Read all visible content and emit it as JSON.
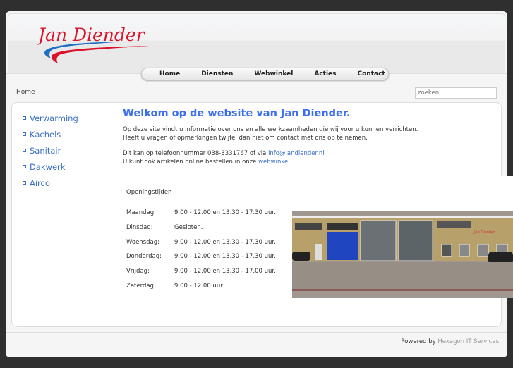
{
  "brand": {
    "name": "Jan Diender",
    "colors": {
      "red": "#d9142a",
      "blue": "#1f6fc4",
      "accent": "#3b6ef0"
    }
  },
  "nav": [
    "Home",
    "Diensten",
    "Webwinkel",
    "Acties",
    "Contact"
  ],
  "breadcrumb": "Home",
  "search": {
    "placeholder": "zoeken..."
  },
  "sidebar": [
    "Verwarming",
    "Kachels",
    "Sanitair",
    "Dakwerk",
    "Airco"
  ],
  "main": {
    "title": "Welkom op de website van Jan Diender.",
    "line1": "Op deze site vindt u informatie over ons en alle werkzaamheden die wij voor u kunnen verrichten.",
    "line2": "Heeft u vragen of opmerkingen twijfel dan niet om contact met ons op te nemen.",
    "line3": "Dit kan op telefoonnummer 038-3331767 of via ",
    "email": "info@jandiender.nl",
    "line4": "U kunt ook artikelen online bestellen in onze ",
    "webshop_link": "webwinkel",
    "line4_end": "."
  },
  "hours": {
    "title": "Openingstijden",
    "rows": [
      {
        "day": "Maandag:",
        "time": "9.00 - 12.00 en 13.30 - 17.30 uur."
      },
      {
        "day": "Dinsdag:",
        "time": "Gesloten."
      },
      {
        "day": "Woensdag:",
        "time": "9.00 - 12.00 en 13.30 - 17.30 uur."
      },
      {
        "day": "Donderdag:",
        "time": "9.00 - 12.00 en 13.30 - 17.30 uur."
      },
      {
        "day": "Vrijdag:",
        "time": "9.00 - 12.00 en 13.30 - 17.00 uur."
      },
      {
        "day": "Zaterdag:",
        "time": "9.00 - 12.00 uur"
      }
    ]
  },
  "footer": {
    "prefix": "Powered by ",
    "link": "Hexagon IT Services"
  }
}
